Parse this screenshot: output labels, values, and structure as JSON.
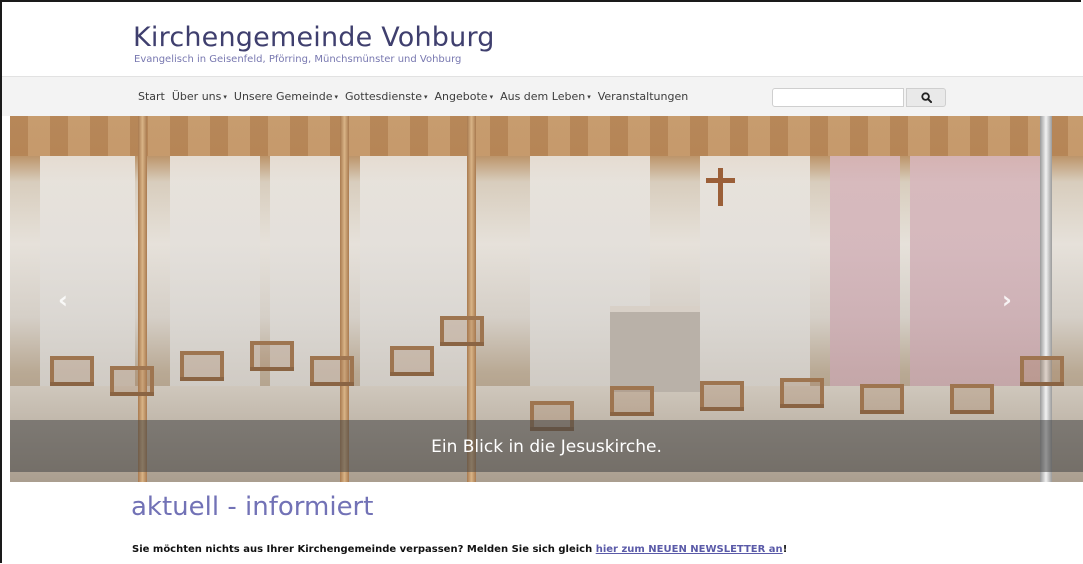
{
  "header": {
    "title": "Kirchengemeinde Vohburg",
    "subtitle": "Evangelisch in Geisenfeld, Pförring, Münchsmünster und Vohburg"
  },
  "nav": {
    "items": [
      {
        "label": "Start",
        "dropdown": false
      },
      {
        "label": "Über uns",
        "dropdown": true
      },
      {
        "label": "Unsere Gemeinde",
        "dropdown": true
      },
      {
        "label": "Gottesdienste",
        "dropdown": true
      },
      {
        "label": "Angebote",
        "dropdown": true
      },
      {
        "label": "Aus dem Leben",
        "dropdown": true
      },
      {
        "label": "Veranstaltungen",
        "dropdown": false
      }
    ],
    "caret": "▾"
  },
  "search": {
    "placeholder": "",
    "button_icon": "search-icon"
  },
  "carousel": {
    "caption": "Ein Blick in die Jesuskirche.",
    "prev_icon": "‹",
    "next_icon": "›"
  },
  "main": {
    "section_title": "aktuell - informiert",
    "notice_text": "Sie möchten nichts aus Ihrer Kirchengemeinde verpassen? Melden Sie sich gleich ",
    "notice_link": "hier zum NEUEN NEWSLETTER an",
    "notice_end": "!"
  },
  "colors": {
    "title": "#3f3f6e",
    "subtitle": "#7878b0",
    "section_title": "#7272b6",
    "link": "#5a5aa8",
    "navbar_bg": "#f3f3f3"
  }
}
